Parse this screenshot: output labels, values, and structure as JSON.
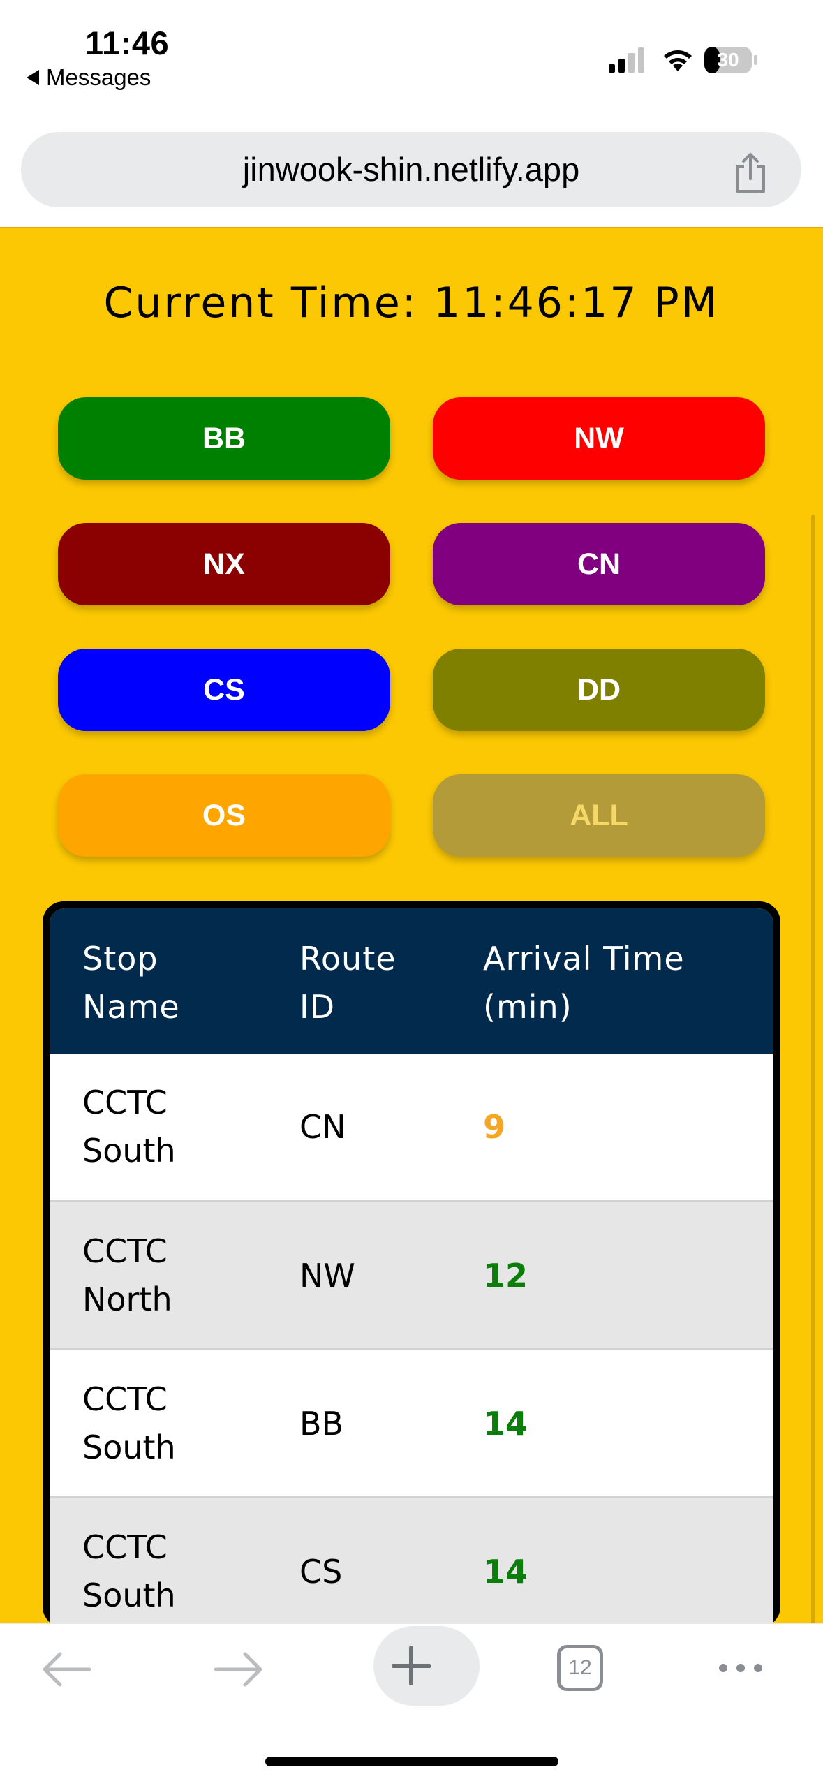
{
  "status_bar": {
    "time": "11:46",
    "back_app": "Messages",
    "battery_level": "30"
  },
  "browser": {
    "url": "jinwook-shin.netlify.app",
    "tab_count": "12"
  },
  "page": {
    "current_time_label": "Current Time: 11:46:17 PM",
    "route_buttons": [
      {
        "label": "BB",
        "color": "#008000",
        "text_color": "#ffffff"
      },
      {
        "label": "NW",
        "color": "#ff0000",
        "text_color": "#ffffff"
      },
      {
        "label": "NX",
        "color": "#8b0000",
        "text_color": "#ffffff"
      },
      {
        "label": "CN",
        "color": "#800080",
        "text_color": "#ffffff"
      },
      {
        "label": "CS",
        "color": "#0000ff",
        "text_color": "#ffffff"
      },
      {
        "label": "DD",
        "color": "#808000",
        "text_color": "#ffffff"
      },
      {
        "label": "OS",
        "color": "#ffa500",
        "text_color": "#ffffff"
      },
      {
        "label": "ALL",
        "color": "#b39b3a",
        "text_color": "#f5d867"
      }
    ],
    "table": {
      "headers": {
        "stop_name": [
          "Stop",
          "Name"
        ],
        "route_id": [
          "Route",
          "ID"
        ],
        "arrival": [
          "Arrival Time",
          "(min)"
        ]
      },
      "rows": [
        {
          "stop": [
            "CCTC",
            "South"
          ],
          "route": "CN",
          "arrival": "9",
          "arrival_color": "#f5a623",
          "bg": "#ffffff"
        },
        {
          "stop": [
            "CCTC",
            "North"
          ],
          "route": "NW",
          "arrival": "12",
          "arrival_color": "#0a7d0a",
          "bg": "#e6e6e6"
        },
        {
          "stop": [
            "CCTC",
            "South"
          ],
          "route": "BB",
          "arrival": "14",
          "arrival_color": "#0a7d0a",
          "bg": "#ffffff"
        },
        {
          "stop": [
            "CCTC",
            "South"
          ],
          "route": "CS",
          "arrival": "14",
          "arrival_color": "#0a7d0a",
          "bg": "#e6e6e6"
        }
      ]
    }
  },
  "colors": {
    "page_background": "#fcc803",
    "table_header": "#022a4c"
  }
}
